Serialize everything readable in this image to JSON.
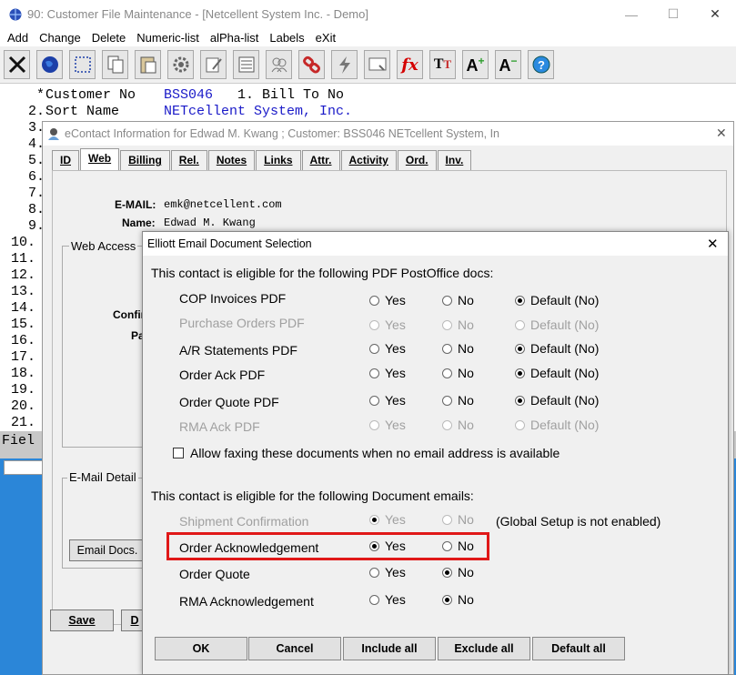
{
  "main": {
    "title": "90: Customer File Maintenance - [Netcellent System Inc. - Demo]",
    "menu": [
      "Add",
      "Change",
      "Delete",
      "Numeric-list",
      "alPha-list",
      "Labels",
      "eXit"
    ],
    "controls": {
      "minimize": "—",
      "maximize": "☐",
      "close": "✕"
    },
    "toolbar_icons": [
      "close-icon",
      "globe-icon",
      "select-icon",
      "copy-icon",
      "paste-icon",
      "gear-icon",
      "edit-icon",
      "list-icon",
      "users-icon",
      "link-icon",
      "lightning-icon",
      "screen-icon",
      "fx-icon",
      "font-icon",
      "font-bigger-icon",
      "font-smaller-icon",
      "help-icon"
    ],
    "console": {
      "rows": [
        {
          "num": "  *",
          "label": "Customer No",
          "value": "BSS046",
          "extra": "1. Bill To No"
        },
        {
          "num": " 2.",
          "label": "Sort Name",
          "value": "NETcellent System, Inc.",
          "extra": ""
        },
        {
          "num": " 3.",
          "label": "",
          "value": "",
          "extra": ""
        },
        {
          "num": " 4.",
          "label": "",
          "value": "",
          "extra": ""
        },
        {
          "num": " 5.",
          "label": "",
          "value": "",
          "extra": ""
        },
        {
          "num": " 6.",
          "label": "",
          "value": "",
          "extra": ""
        },
        {
          "num": " 7.",
          "label": "",
          "value": "",
          "extra": ""
        },
        {
          "num": " 8.",
          "label": "",
          "value": "",
          "extra": ""
        },
        {
          "num": " 9.",
          "label": "",
          "value": "",
          "extra": ""
        },
        {
          "num": "10.",
          "label": "",
          "value": "",
          "extra": ""
        },
        {
          "num": "11.",
          "label": "",
          "value": "",
          "extra": ""
        },
        {
          "num": "12.",
          "label": "",
          "value": "",
          "extra": ""
        },
        {
          "num": "13.",
          "label": "",
          "value": "",
          "extra": ""
        },
        {
          "num": "14.",
          "label": "",
          "value": "",
          "extra": ""
        },
        {
          "num": "15.",
          "label": "",
          "value": "",
          "extra": ""
        },
        {
          "num": "16.",
          "label": "",
          "value": "",
          "extra": ""
        },
        {
          "num": "17.",
          "label": "",
          "value": "",
          "extra": ""
        },
        {
          "num": "18.",
          "label": "",
          "value": "",
          "extra": ""
        },
        {
          "num": "19.",
          "label": "",
          "value": "",
          "extra": ""
        },
        {
          "num": "20.",
          "label": "",
          "value": "",
          "extra": ""
        },
        {
          "num": "21.",
          "label": "",
          "value": "",
          "extra": ""
        }
      ],
      "field_label": "Fiel"
    }
  },
  "econtact": {
    "title": "eContact Information for Edwad M. Kwang ; Customer: BSS046 NETcellent System, In",
    "tabs": [
      "ID",
      "Web",
      "Billing",
      "Rel.",
      "Notes",
      "Links",
      "Attr.",
      "Activity",
      "Ord.",
      "Inv."
    ],
    "email_label": "E-MAIL:",
    "email_value": "emk@netcellent.com",
    "name_label": "Name:",
    "name_value": "Edwad M. Kwang",
    "web_access_label": "Web Access",
    "confirm_label": "Confir",
    "pa_label": "Pa",
    "email_details_label": "E-Mail Detail",
    "email_docs_button": "Email Docs.",
    "save_button": "Save",
    "d_button": "D"
  },
  "dialog": {
    "title": "Elliott Email Document Selection",
    "close": "✕",
    "pdf_header": "This contact is eligible for the following PDF PostOffice docs:",
    "pdf_rows": [
      {
        "label": "COP Invoices PDF",
        "selected": "default",
        "disabled": false
      },
      {
        "label": "Purchase Orders PDF",
        "selected": "none",
        "disabled": true
      },
      {
        "label": "A/R Statements PDF",
        "selected": "default",
        "disabled": false
      },
      {
        "label": "Order Ack PDF",
        "selected": "default",
        "disabled": false
      },
      {
        "label": "Order Quote PDF",
        "selected": "default",
        "disabled": false
      },
      {
        "label": "RMA Ack PDF",
        "selected": "none",
        "disabled": true
      }
    ],
    "yes_label": "Yes",
    "no_label": "No",
    "default_label": "Default (No)",
    "fax_checkbox": "Allow faxing these documents when no email address is available",
    "doc_header": "This contact is eligible for the following Document emails:",
    "doc_rows": [
      {
        "label": "Shipment Confirmation",
        "selected": "yes",
        "disabled": true
      },
      {
        "label": "Order Acknowledgement",
        "selected": "yes",
        "disabled": false
      },
      {
        "label": "Order Quote",
        "selected": "no",
        "disabled": false
      },
      {
        "label": "RMA Acknowledgement",
        "selected": "no",
        "disabled": false
      }
    ],
    "global_note": "(Global Setup is not enabled)",
    "buttons": [
      "OK",
      "Cancel",
      "Include all",
      "Exclude all",
      "Default all"
    ],
    "highlight_color": "#e01818"
  }
}
